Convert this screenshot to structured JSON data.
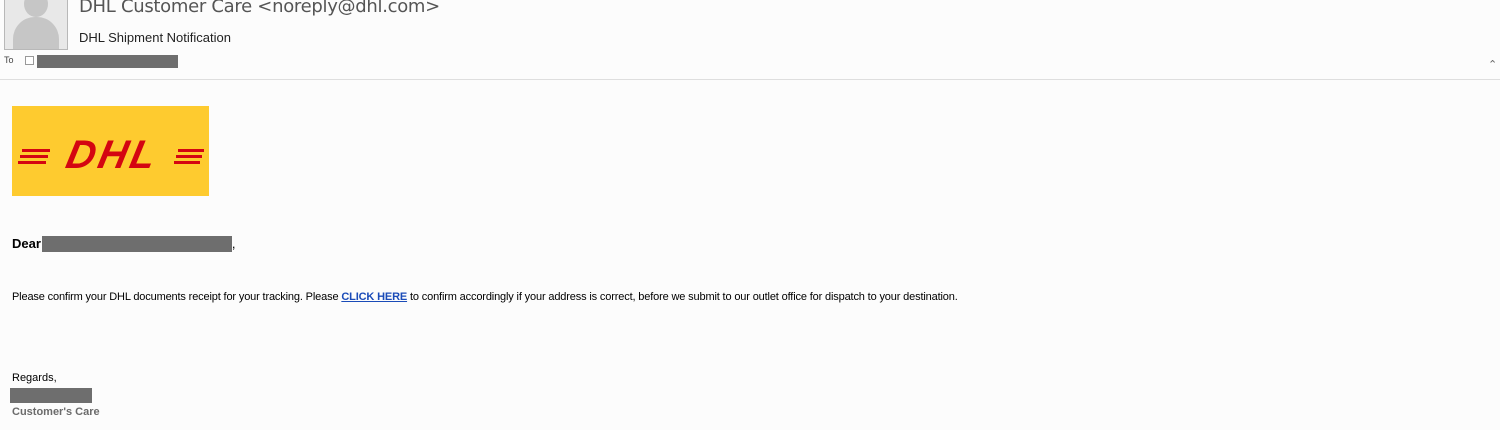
{
  "header": {
    "sender": "DHL Customer Care <noreply@dhl.com>",
    "subject": "DHL Shipment Notification",
    "to_label": "To",
    "collapse_icon": "chevron-up-icon"
  },
  "logo": {
    "text": "DHL",
    "background": "#fecb2f",
    "color": "#d40511"
  },
  "message": {
    "greeting": "Dear",
    "greeting_comma": ",",
    "body_before_link": "Please confirm your DHL documents receipt for your tracking. Please ",
    "link_text": "CLICK HERE",
    "body_after_link": " to confirm accordingly if your address is correct, before we submit to our outlet office for dispatch to your destination.",
    "regards": "Regards,",
    "signature_title": "Customer's Care"
  }
}
